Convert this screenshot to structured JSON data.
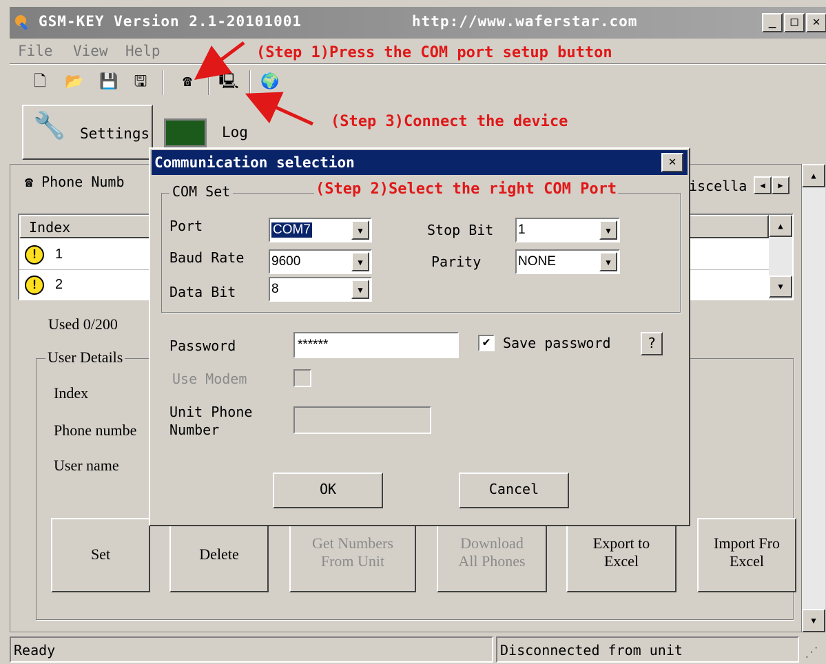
{
  "window": {
    "title": "GSM-KEY Version 2.1-20101001",
    "url": "http://www.waferstar.com",
    "minimize": "_",
    "maximize": "□",
    "close": "✕"
  },
  "menu": [
    "File",
    "View",
    "Help"
  ],
  "annotations": {
    "step1": "(Step 1)Press the COM port setup button",
    "step2": "(Step 2)Select the right COM Port",
    "step3": "(Step 3)Connect the device"
  },
  "toolbar": {
    "icons": [
      "new-file-icon",
      "open-folder-icon",
      "save-icon",
      "save-all-icon",
      "com-setup-icon",
      "connect-icon",
      "globe-icon"
    ]
  },
  "tabs": {
    "settings": "Settings",
    "log": "Log"
  },
  "subtabs": {
    "phone_numbers": "Phone Numb",
    "miscellaneous": "iscella"
  },
  "table": {
    "header": "Index",
    "rows": [
      "1",
      "2"
    ]
  },
  "used": "Used 0/200",
  "user_details": {
    "legend": "User Details",
    "index_label": "Index",
    "phone_label": "Phone numbe",
    "name_label": "User name"
  },
  "buttons": {
    "set": "Set",
    "delete": "Delete",
    "get_numbers_1": "Get Numbers",
    "get_numbers_2": "From Unit",
    "download_1": "Download",
    "download_2": "All Phones",
    "export_1": "Export to",
    "export_2": "Excel",
    "import_1": "Import Fro",
    "import_2": "Excel"
  },
  "status": {
    "left": "Ready",
    "right": "Disconnected from unit"
  },
  "dialog": {
    "title": "Communication selection",
    "close": "✕",
    "group": "COM Set",
    "port_label": "Port",
    "port_value": "COM7",
    "baud_label": "Baud Rate",
    "baud_value": "9600",
    "data_label": "Data Bit",
    "data_value": "8",
    "stop_label": "Stop Bit",
    "stop_value": "1",
    "parity_label": "Parity",
    "parity_value": "NONE",
    "password_label": "Password",
    "password_value": "******",
    "save_password": "Save password",
    "save_password_checked": true,
    "help": "?",
    "use_modem": "Use Modem",
    "unit_phone_1": "Unit Phone",
    "unit_phone_2": "Number",
    "ok": "OK",
    "cancel": "Cancel"
  }
}
